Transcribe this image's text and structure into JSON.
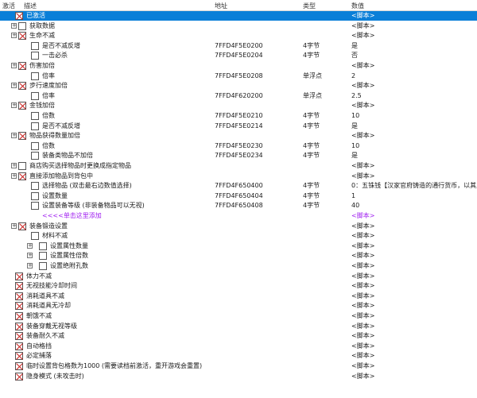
{
  "header": {
    "active": "激活",
    "description": "描述",
    "address": "地址",
    "type": "类型",
    "value": "数值"
  },
  "rows": [
    {
      "expand": "",
      "box": "checked",
      "indent": 0,
      "desc": "已激活",
      "addr": "",
      "type": "",
      "value": "<脚本>",
      "selected": true,
      "color": "green"
    },
    {
      "expand": "+",
      "box": "unchecked",
      "indent": 1,
      "desc": "获取数据",
      "addr": "",
      "type": "",
      "value": "<脚本>"
    },
    {
      "expand": "+",
      "box": "checked",
      "indent": 1,
      "desc": "生命不减",
      "addr": "",
      "type": "",
      "value": "<脚本>"
    },
    {
      "expand": "",
      "box": "unchecked",
      "indent": 2,
      "desc": "是否不减反增",
      "addr": "7FFD4F5E0200",
      "type": "4字节",
      "value": "是"
    },
    {
      "expand": "",
      "box": "unchecked",
      "indent": 2,
      "desc": "一击必杀",
      "addr": "7FFD4F5E0204",
      "type": "4字节",
      "value": "否"
    },
    {
      "expand": "+",
      "box": "checked",
      "indent": 1,
      "desc": "伤害加倍",
      "addr": "",
      "type": "",
      "value": "<脚本>"
    },
    {
      "expand": "",
      "box": "unchecked",
      "indent": 2,
      "desc": "倍率",
      "addr": "7FFD4F5E0208",
      "type": "单浮点",
      "value": "2"
    },
    {
      "expand": "+",
      "box": "checked",
      "indent": 1,
      "desc": "步行速度加倍",
      "addr": "",
      "type": "",
      "value": "<脚本>"
    },
    {
      "expand": "",
      "box": "unchecked",
      "indent": 2,
      "desc": "倍率",
      "addr": "7FFD4F620200",
      "type": "单浮点",
      "value": "2.5"
    },
    {
      "expand": "+",
      "box": "checked",
      "indent": 1,
      "desc": "金钱加倍",
      "addr": "",
      "type": "",
      "value": "<脚本>"
    },
    {
      "expand": "",
      "box": "unchecked",
      "indent": 2,
      "desc": "倍数",
      "addr": "7FFD4F5E0210",
      "type": "4字节",
      "value": "10"
    },
    {
      "expand": "",
      "box": "unchecked",
      "indent": 2,
      "desc": "是否不减反增",
      "addr": "7FFD4F5E0214",
      "type": "4字节",
      "value": "是"
    },
    {
      "expand": "+",
      "box": "checked",
      "indent": 1,
      "desc": "物品获得数量加倍",
      "addr": "",
      "type": "",
      "value": "<脚本>"
    },
    {
      "expand": "",
      "box": "unchecked",
      "indent": 2,
      "desc": "倍数",
      "addr": "7FFD4F5E0230",
      "type": "4字节",
      "value": "10"
    },
    {
      "expand": "",
      "box": "unchecked",
      "indent": 2,
      "desc": "装备类物品不加倍",
      "addr": "7FFD4F5E0234",
      "type": "4字节",
      "value": "是"
    },
    {
      "expand": "+",
      "box": "unchecked",
      "indent": 1,
      "desc": "商店购买选择物品时更换成指定物品",
      "addr": "",
      "type": "",
      "value": "<脚本>"
    },
    {
      "expand": "+",
      "box": "checked",
      "indent": 1,
      "desc": "直接添加物品到背包中",
      "addr": "",
      "type": "",
      "value": "<脚本>"
    },
    {
      "expand": "",
      "box": "unchecked",
      "indent": 2,
      "desc": "选择物品 (双击最右边数值选择)",
      "addr": "7FFD4F650400",
      "type": "4字节",
      "value": "0：五铢钱【汉家官府铸造的通行货币，以其上"
    },
    {
      "expand": "",
      "box": "unchecked",
      "indent": 2,
      "desc": "设置数量",
      "addr": "7FFD4F650404",
      "type": "4字节",
      "value": "1"
    },
    {
      "expand": "",
      "box": "unchecked",
      "indent": 2,
      "desc": "设置装备等级 (非装备物品可以无视)",
      "addr": "7FFD4F650408",
      "type": "4字节",
      "value": "40"
    },
    {
      "expand": "",
      "box": "none",
      "indent": 2,
      "desc": "<<<<单击这里添加",
      "addr": "",
      "type": "",
      "value": "<脚本>",
      "color": "purple"
    },
    {
      "expand": "+",
      "box": "checked",
      "indent": 1,
      "desc": "装备锻造设置",
      "addr": "",
      "type": "",
      "value": "<脚本>"
    },
    {
      "expand": "",
      "box": "unchecked",
      "indent": 2,
      "desc": "材料不减",
      "addr": "",
      "type": "",
      "value": "<脚本>"
    },
    {
      "expand": "+",
      "box": "unchecked",
      "indent": 3,
      "desc": "设置属性数量",
      "addr": "",
      "type": "",
      "value": "<脚本>"
    },
    {
      "expand": "+",
      "box": "unchecked",
      "indent": 3,
      "desc": "设置属性倍数",
      "addr": "",
      "type": "",
      "value": "<脚本>"
    },
    {
      "expand": "+",
      "box": "unchecked",
      "indent": 3,
      "desc": "设置绝附孔数",
      "addr": "",
      "type": "",
      "value": "<脚本>"
    },
    {
      "expand": "",
      "box": "checked",
      "indent": 0,
      "desc": "体力不减",
      "addr": "",
      "type": "",
      "value": "<脚本>"
    },
    {
      "expand": "",
      "box": "checked",
      "indent": 0,
      "desc": "无视技能冷却时间",
      "addr": "",
      "type": "",
      "value": "<脚本>"
    },
    {
      "expand": "",
      "box": "checked",
      "indent": 0,
      "desc": "消耗道具不减",
      "addr": "",
      "type": "",
      "value": "<脚本>"
    },
    {
      "expand": "",
      "box": "checked",
      "indent": 0,
      "desc": "消耗道具无冷却",
      "addr": "",
      "type": "",
      "value": "<脚本>"
    },
    {
      "expand": "",
      "box": "checked",
      "indent": 0,
      "desc": "朝饿不减",
      "addr": "",
      "type": "",
      "value": "<脚本>"
    },
    {
      "expand": "",
      "box": "checked",
      "indent": 0,
      "desc": "装备穿戴无视等级",
      "addr": "",
      "type": "",
      "value": "<脚本>"
    },
    {
      "expand": "",
      "box": "checked",
      "indent": 0,
      "desc": "装备耐久不减",
      "addr": "",
      "type": "",
      "value": "<脚本>"
    },
    {
      "expand": "",
      "box": "checked",
      "indent": 0,
      "desc": "自动格挡",
      "addr": "",
      "type": "",
      "value": "<脚本>"
    },
    {
      "expand": "",
      "box": "checked",
      "indent": 0,
      "desc": "必定捕落",
      "addr": "",
      "type": "",
      "value": "<脚本>"
    },
    {
      "expand": "",
      "box": "checked",
      "indent": 0,
      "desc": "临时设置背包格数为1000 (需要读档前激活，重开游戏会重置)",
      "addr": "",
      "type": "",
      "value": "<脚本>"
    },
    {
      "expand": "",
      "box": "checked",
      "indent": 0,
      "desc": "隐身模式 (未攻击时)",
      "addr": "",
      "type": "",
      "value": "<脚本>"
    }
  ]
}
